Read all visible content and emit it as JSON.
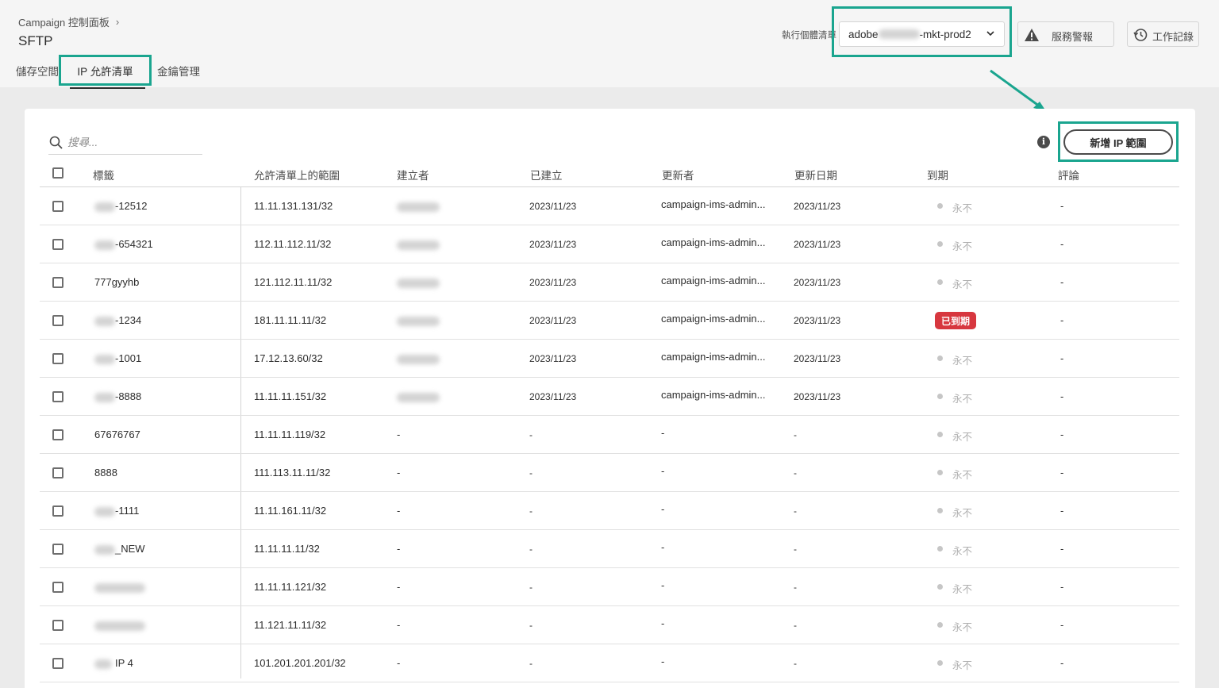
{
  "breadcrumb": {
    "root": "Campaign 控制面板",
    "separator": "›"
  },
  "page_title": "SFTP",
  "tabs": {
    "storage": "儲存空間",
    "ip_allowlist": "IP 允許清單",
    "key_management": "金鑰管理"
  },
  "instance": {
    "label": "執行個體清單",
    "value_prefix": "adobe",
    "value_suffix": "-mkt-prod2"
  },
  "header_buttons": {
    "alerts": "服務警報",
    "log": "工作記錄"
  },
  "search": {
    "placeholder": "搜尋..."
  },
  "add_button": "新增 IP 範圍",
  "table": {
    "headers": {
      "label": "標籤",
      "range": "允許清單上的範圍",
      "created_by": "建立者",
      "created": "已建立",
      "updated_by": "更新者",
      "updated_date": "更新日期",
      "expiry": "到期",
      "comment": "評論"
    },
    "rows": [
      {
        "label": "-12512",
        "range": "11.11.131.131/32",
        "created_by": "",
        "created": "2023/11/23",
        "updated_by": "campaign-ims-admin...",
        "updated_date": "2023/11/23",
        "expiry": "永不",
        "expired": false,
        "comment": "-"
      },
      {
        "label": "-654321",
        "range": "112.11.112.11/32",
        "created_by": "",
        "created": "2023/11/23",
        "updated_by": "campaign-ims-admin...",
        "updated_date": "2023/11/23",
        "expiry": "永不",
        "expired": false,
        "comment": "-"
      },
      {
        "label": "777gyyhb",
        "range": "121.112.11.11/32",
        "created_by": "",
        "created": "2023/11/23",
        "updated_by": "campaign-ims-admin...",
        "updated_date": "2023/11/23",
        "expiry": "永不",
        "expired": false,
        "comment": "-"
      },
      {
        "label": "-1234",
        "range": "181.11.11.11/32",
        "created_by": "",
        "created": "2023/11/23",
        "updated_by": "campaign-ims-admin...",
        "updated_date": "2023/11/23",
        "expiry": "已到期",
        "expired": true,
        "comment": "-"
      },
      {
        "label": "-1001",
        "range": "17.12.13.60/32",
        "created_by": "",
        "created": "2023/11/23",
        "updated_by": "campaign-ims-admin...",
        "updated_date": "2023/11/23",
        "expiry": "永不",
        "expired": false,
        "comment": "-"
      },
      {
        "label": "-8888",
        "range": "11.11.11.151/32",
        "created_by": "",
        "created": "2023/11/23",
        "updated_by": "campaign-ims-admin...",
        "updated_date": "2023/11/23",
        "expiry": "永不",
        "expired": false,
        "comment": "-"
      },
      {
        "label": "67676767",
        "range": "11.11.11.119/32",
        "created_by": "-",
        "created": "-",
        "updated_by": "-",
        "updated_date": "-",
        "expiry": "永不",
        "expired": false,
        "comment": "-"
      },
      {
        "label": "8888",
        "range": "111.113.11.11/32",
        "created_by": "-",
        "created": "-",
        "updated_by": "-",
        "updated_date": "-",
        "expiry": "永不",
        "expired": false,
        "comment": "-"
      },
      {
        "label": "-1111",
        "range": "11.11.161.11/32",
        "created_by": "-",
        "created": "-",
        "updated_by": "-",
        "updated_date": "-",
        "expiry": "永不",
        "expired": false,
        "comment": "-"
      },
      {
        "label": "_NEW",
        "range": "11.11.11.11/32",
        "created_by": "-",
        "created": "-",
        "updated_by": "-",
        "updated_date": "-",
        "expiry": "永不",
        "expired": false,
        "comment": "-"
      },
      {
        "label": "",
        "range": "11.11.11.121/32",
        "created_by": "-",
        "created": "-",
        "updated_by": "-",
        "updated_date": "-",
        "expiry": "永不",
        "expired": false,
        "comment": "-"
      },
      {
        "label": "",
        "range": "11.121.11.11/32",
        "created_by": "-",
        "created": "-",
        "updated_by": "-",
        "updated_date": "-",
        "expiry": "永不",
        "expired": false,
        "comment": "-"
      },
      {
        "label": "IP 4",
        "range": "101.201.201.201/32",
        "created_by": "-",
        "created": "-",
        "updated_by": "-",
        "updated_date": "-",
        "expiry": "永不",
        "expired": false,
        "comment": "-"
      }
    ]
  },
  "colors": {
    "highlight": "#1aa58f",
    "expired": "#d7373f"
  }
}
